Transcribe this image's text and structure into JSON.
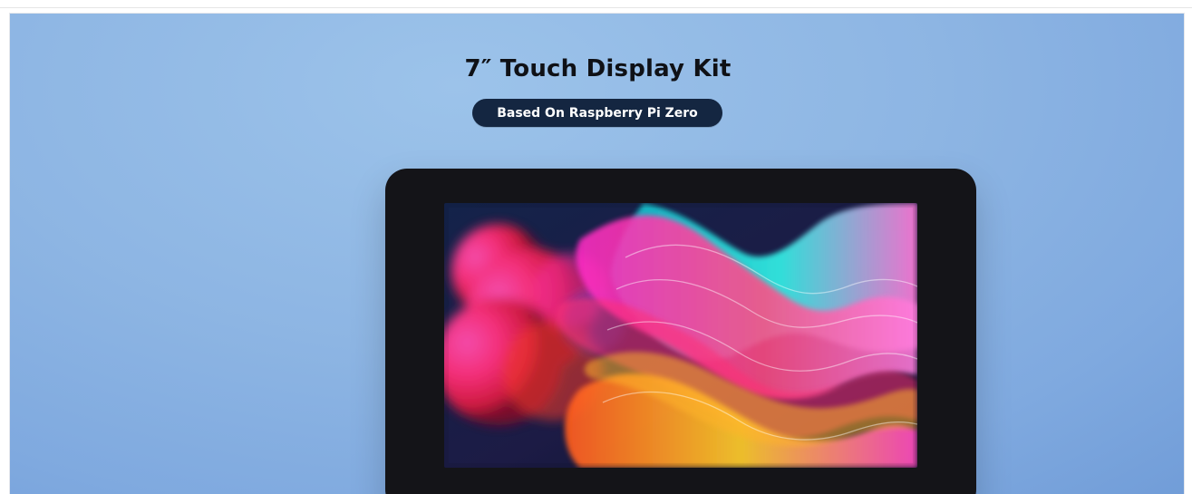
{
  "page": {
    "title": "7″ Touch Display Kit",
    "subtitle": "Based On Raspberry Pi Zero"
  },
  "colors": {
    "background_start": "#9cc3ea",
    "background_end": "#6f9bd7",
    "title_text": "#0f1116",
    "pill_bg": "#142641",
    "pill_text": "#ffffff",
    "device_bezel": "#141418",
    "screen_base": "#0d1730"
  }
}
